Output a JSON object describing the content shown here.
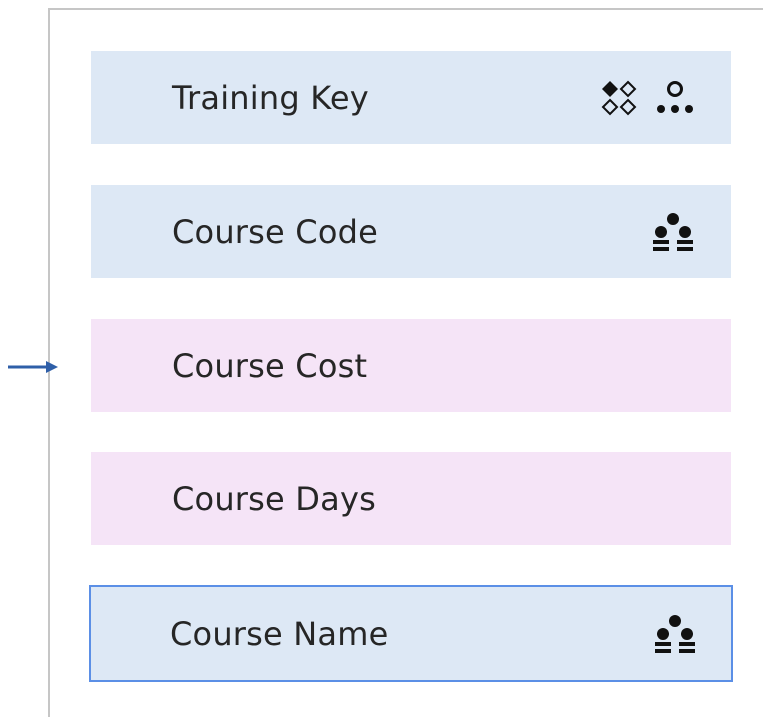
{
  "fields": [
    {
      "label": "Training Key",
      "category": "key",
      "icons": [
        "key-diamonds-icon",
        "hierarchy-icon"
      ],
      "selected": false
    },
    {
      "label": "Course Code",
      "category": "key",
      "icons": [
        "dimension-icon"
      ],
      "selected": false
    },
    {
      "label": "Course Cost",
      "category": "measure",
      "icons": [],
      "selected": false
    },
    {
      "label": "Course Days",
      "category": "measure",
      "icons": [],
      "selected": false
    },
    {
      "label": "Course Name",
      "category": "key",
      "icons": [
        "dimension-icon"
      ],
      "selected": true
    }
  ],
  "colors": {
    "key_background": "#dde8f5",
    "measure_background": "#f5e4f7",
    "selection_border": "#5b8fe6",
    "arrow": "#2f5fa8",
    "text": "#262626"
  }
}
